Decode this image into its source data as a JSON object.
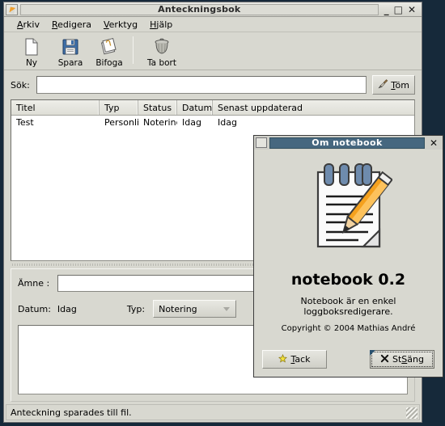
{
  "desktop": {
    "background": "#16293a"
  },
  "main_window": {
    "title": "Anteckningsbok",
    "icon": "notebook-pencil-icon",
    "controls": {
      "minimize": "_",
      "maximize": "□",
      "close": "✕"
    },
    "menubar": [
      {
        "name": "arkiv",
        "mnemonic": "A",
        "rest": "rkiv"
      },
      {
        "name": "redigera",
        "mnemonic": "R",
        "rest": "edigera"
      },
      {
        "name": "verktyg",
        "mnemonic": "V",
        "rest": "erktyg"
      },
      {
        "name": "hjalp",
        "mnemonic": "H",
        "rest": "jälp"
      }
    ],
    "toolbar": [
      {
        "name": "new",
        "label": "Ny",
        "icon": "new-document-icon"
      },
      {
        "name": "save",
        "label": "Spara",
        "icon": "floppy-disk-icon"
      },
      {
        "name": "attach",
        "label": "Bifoga",
        "icon": "attach-notes-icon"
      },
      {
        "name": "delete",
        "label": "Ta bort",
        "icon": "trash-can-icon"
      }
    ],
    "search": {
      "label": "Sök:",
      "value": "",
      "placeholder": "",
      "clear_button": {
        "mnemonic": "T",
        "rest": "öm",
        "icon": "broom-icon"
      }
    },
    "list": {
      "columns": [
        {
          "label": "Titel",
          "width": 109
        },
        {
          "label": "Typ",
          "width": 48
        },
        {
          "label": "Status",
          "width": 48
        },
        {
          "label": "Datum",
          "width": 44
        },
        {
          "label": "Senast uppdaterad",
          "width": 0
        }
      ],
      "rows": [
        {
          "titel": "Test",
          "typ": "Personlig",
          "status": "Notering",
          "datum": "Idag",
          "senast": "Idag"
        }
      ]
    },
    "form": {
      "subject_label": "Ämne :",
      "subject_value": "",
      "date_label": "Datum:",
      "date_value": "Idag",
      "type_label": "Typ:",
      "type_selected": "Notering",
      "type_options": [
        "Notering"
      ],
      "body_value": ""
    },
    "statusbar": {
      "text": "Anteckning sparades till fil."
    }
  },
  "about_dialog": {
    "title": "Om notebook",
    "icon": "window-menu-icon",
    "close_glyph": "✕",
    "app_icon": "notepad-pencil-icon",
    "app_name": "notebook 0.2",
    "description": "Notebook är en enkel loggboksredigerare.",
    "copyright": "Copyright © 2004 Mathias André",
    "buttons": [
      {
        "name": "credits",
        "mnemonic": "T",
        "rest": "ack",
        "icon": "star-icon",
        "focused": false
      },
      {
        "name": "close",
        "mnemonic": "S",
        "pre": "St",
        "rest": "äng",
        "icon": "x-icon",
        "focused": true
      }
    ],
    "accent_color": "#46677f"
  }
}
